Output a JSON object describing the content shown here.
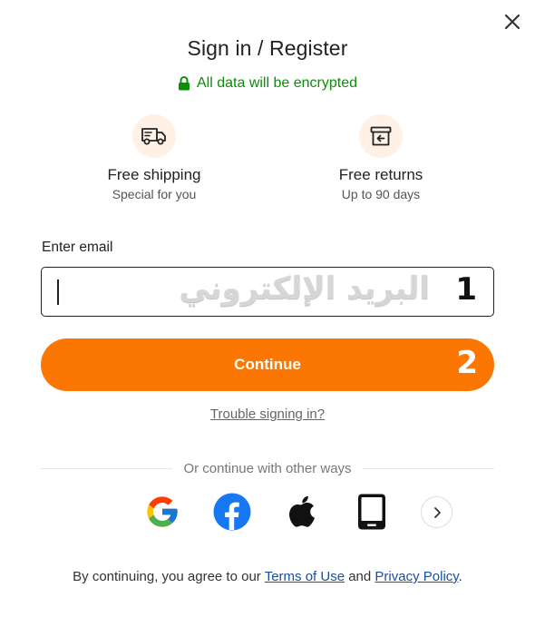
{
  "dialog": {
    "title": "Sign in / Register",
    "secure_note": "All data will be encrypted",
    "secure_color": "#0a8f08",
    "accent_color": "#fb7701"
  },
  "perks": [
    {
      "icon": "truck-icon",
      "title": "Free shipping",
      "subtitle": "Special for you"
    },
    {
      "icon": "return-box-icon",
      "title": "Free returns",
      "subtitle": "Up to 90 days"
    }
  ],
  "email": {
    "label": "Enter email",
    "value": "",
    "placeholder": ""
  },
  "annotations": {
    "arabic_overlay": "البريد الإلكتروني",
    "marker_1": "1",
    "marker_2": "2"
  },
  "continue_label": "Continue",
  "trouble_link": "Trouble signing in?",
  "divider_text": "Or continue with other ways",
  "social_options": [
    {
      "icon": "google-icon"
    },
    {
      "icon": "facebook-icon"
    },
    {
      "icon": "apple-icon"
    },
    {
      "icon": "phone-icon"
    },
    {
      "icon": "chevron-right-icon"
    }
  ],
  "legal": {
    "prefix": "By continuing, you agree to our ",
    "terms": "Terms of Use",
    "middle": " and ",
    "privacy": "Privacy Policy",
    "suffix": "."
  }
}
